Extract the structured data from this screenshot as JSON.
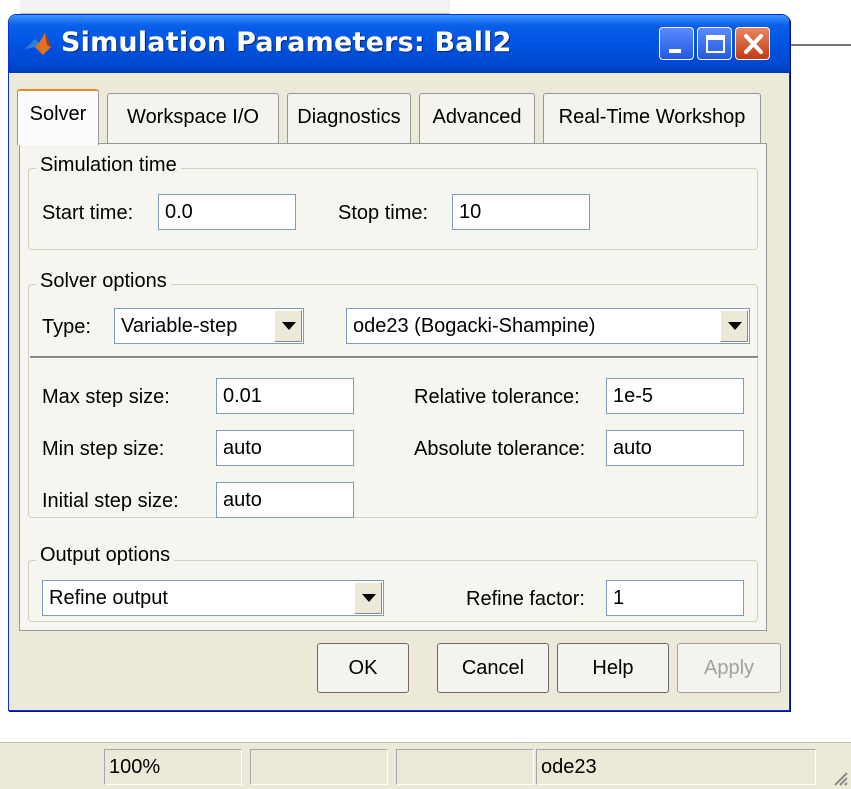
{
  "window": {
    "title": "Simulation Parameters: Ball2",
    "icons": [
      "matlab-logo-icon",
      "minimize-icon",
      "maximize-icon",
      "close-icon"
    ]
  },
  "tabs": [
    {
      "label": "Solver",
      "active": true
    },
    {
      "label": "Workspace I/O",
      "active": false
    },
    {
      "label": "Diagnostics",
      "active": false
    },
    {
      "label": "Advanced",
      "active": false
    },
    {
      "label": "Real-Time Workshop",
      "active": false
    }
  ],
  "simulation_time": {
    "group_label": "Simulation time",
    "start_label": "Start time:",
    "start_value": "0.0",
    "stop_label": "Stop time:",
    "stop_value": "10"
  },
  "solver_options": {
    "group_label": "Solver options",
    "type_label": "Type:",
    "type_value": "Variable-step",
    "solver_value": "ode23 (Bogacki-Shampine)",
    "max_step_label": "Max step size:",
    "max_step_value": "0.01",
    "min_step_label": "Min step size:",
    "min_step_value": "auto",
    "initial_step_label": "Initial step size:",
    "initial_step_value": "auto",
    "rel_tol_label": "Relative tolerance:",
    "rel_tol_value": "1e-5",
    "abs_tol_label": "Absolute tolerance:",
    "abs_tol_value": "auto"
  },
  "output_options": {
    "group_label": "Output options",
    "output_value": "Refine output",
    "refine_label": "Refine factor:",
    "refine_value": "1"
  },
  "buttons": {
    "ok": "OK",
    "cancel": "Cancel",
    "help": "Help",
    "apply": "Apply"
  },
  "statusbar": {
    "zoom": "100%",
    "solver": "ode23"
  },
  "colors": {
    "titlebar": "#0054e3",
    "dialog_bg": "#ece9d8",
    "close_button": "#c23b12",
    "active_tab_accent": "#e68b2c"
  }
}
